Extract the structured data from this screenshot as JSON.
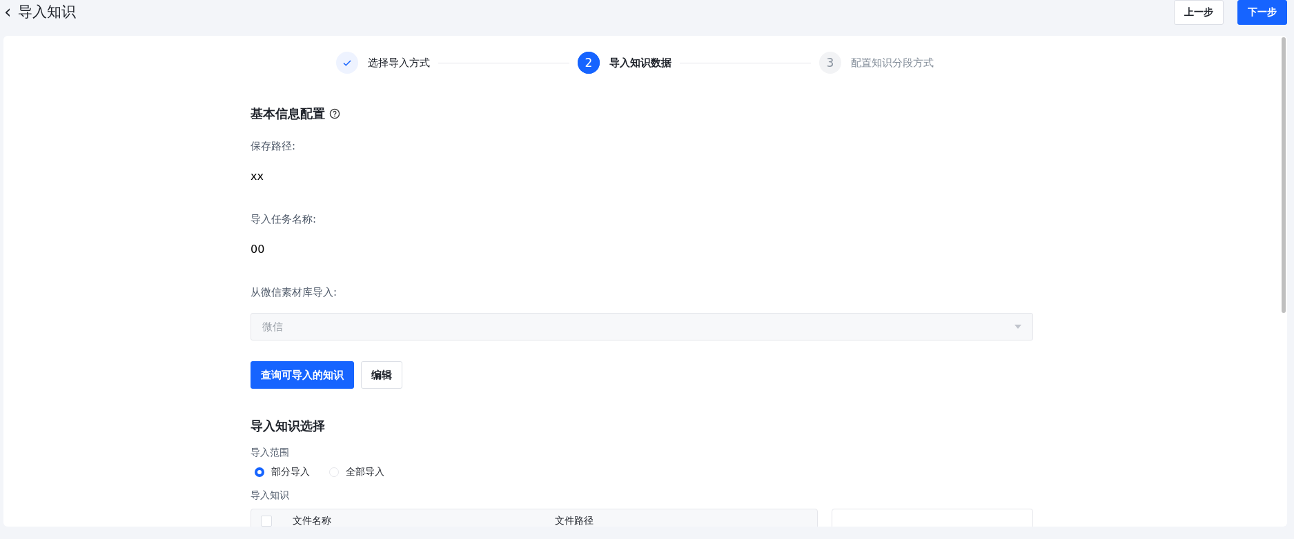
{
  "header": {
    "back_icon": "‹",
    "title": "导入知识",
    "buttons": [
      {
        "label": "上一步",
        "kind": "default"
      },
      {
        "label": "下一步",
        "kind": "primary"
      }
    ]
  },
  "steps": [
    {
      "label": "选择导入方式",
      "done": true,
      "selected": false
    },
    {
      "number": "2",
      "label": "导入知识数据",
      "done": false,
      "selected": true
    },
    {
      "number": "3",
      "label": "配置知识分段方式",
      "done": false,
      "selected": false
    }
  ],
  "basic_info": {
    "title": "基本信息配置",
    "fields": [
      {
        "label": "保存路径:",
        "value": "xx"
      },
      {
        "label": "导入任务名称:",
        "value": "00"
      }
    ],
    "source": {
      "label": "从微信素材库导入:",
      "placeholder": "微信",
      "disabled": true
    },
    "buttons": [
      {
        "label": "查询可导入的知识",
        "kind": "primary"
      },
      {
        "label": "编辑",
        "kind": "default"
      }
    ]
  },
  "selection": {
    "title": "导入知识选择",
    "scope_label": "导入范围",
    "options": [
      {
        "label": "部分导入",
        "selected": true
      },
      {
        "label": "全部导入",
        "selected": false
      }
    ],
    "knowledge_label": "导入知识",
    "table": {
      "checked": false,
      "columns": [
        "文件名称",
        "文件路径"
      ]
    }
  }
}
